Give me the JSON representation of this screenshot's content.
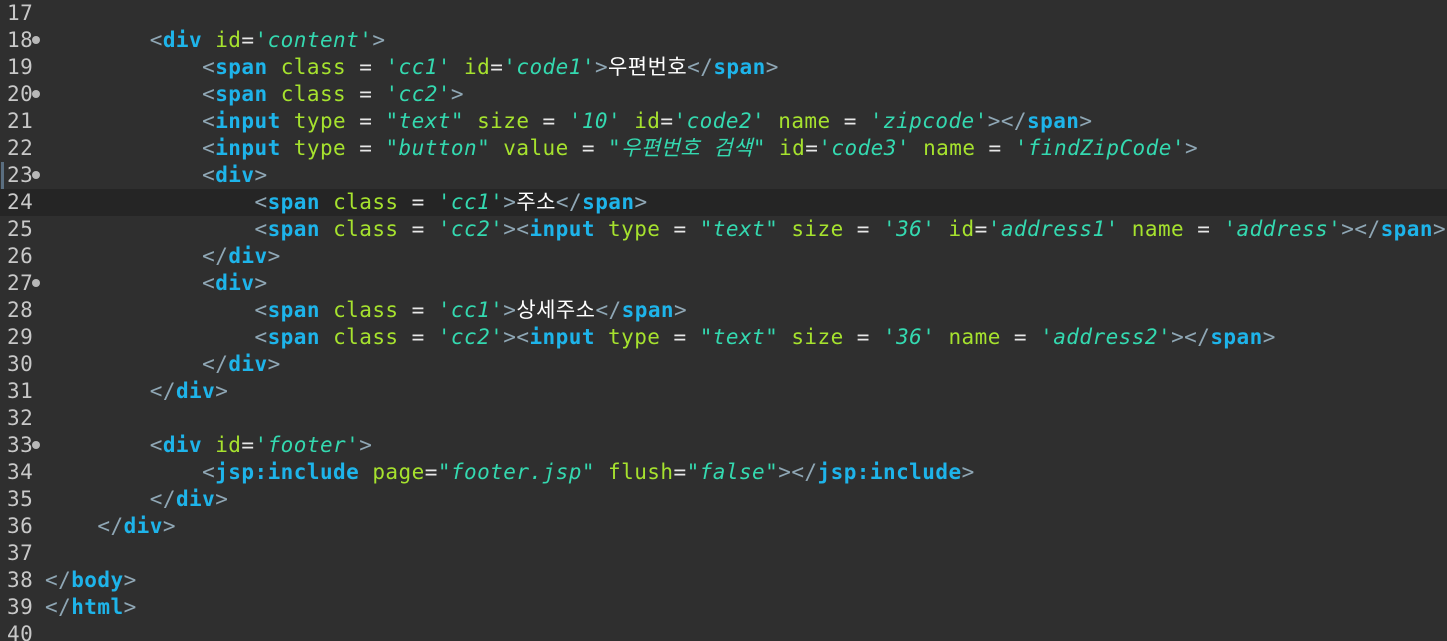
{
  "editor": {
    "first_line": 17,
    "current_line": 24,
    "lines": [
      {
        "n": "17",
        "fold": false,
        "indent": 0,
        "tokens": []
      },
      {
        "n": "18",
        "fold": true,
        "indent": 8,
        "tokens": [
          {
            "t": "bracket",
            "v": "<"
          },
          {
            "t": "tag",
            "v": "div"
          },
          {
            "t": "space",
            "v": " "
          },
          {
            "t": "attr",
            "v": "id"
          },
          {
            "t": "op",
            "v": "="
          },
          {
            "t": "str",
            "v": "'content'"
          },
          {
            "t": "bracket",
            "v": ">"
          }
        ]
      },
      {
        "n": "19",
        "fold": false,
        "indent": 12,
        "tokens": [
          {
            "t": "bracket",
            "v": "<"
          },
          {
            "t": "tag",
            "v": "span"
          },
          {
            "t": "space",
            "v": " "
          },
          {
            "t": "attr",
            "v": "class"
          },
          {
            "t": "op",
            "v": " = "
          },
          {
            "t": "str",
            "v": "'cc1'"
          },
          {
            "t": "space",
            "v": " "
          },
          {
            "t": "attr",
            "v": "id"
          },
          {
            "t": "op",
            "v": "="
          },
          {
            "t": "str",
            "v": "'code1'"
          },
          {
            "t": "bracket",
            "v": ">"
          },
          {
            "t": "text",
            "v": "우편번호"
          },
          {
            "t": "bracket",
            "v": "</"
          },
          {
            "t": "tag",
            "v": "span"
          },
          {
            "t": "bracket",
            "v": ">"
          }
        ]
      },
      {
        "n": "20",
        "fold": true,
        "indent": 12,
        "tokens": [
          {
            "t": "bracket",
            "v": "<"
          },
          {
            "t": "tag",
            "v": "span"
          },
          {
            "t": "space",
            "v": " "
          },
          {
            "t": "attr",
            "v": "class"
          },
          {
            "t": "op",
            "v": " = "
          },
          {
            "t": "str",
            "v": "'cc2'"
          },
          {
            "t": "bracket",
            "v": ">"
          }
        ]
      },
      {
        "n": "21",
        "fold": false,
        "indent": 12,
        "tokens": [
          {
            "t": "bracket",
            "v": "<"
          },
          {
            "t": "tag",
            "v": "input"
          },
          {
            "t": "space",
            "v": " "
          },
          {
            "t": "attr",
            "v": "type"
          },
          {
            "t": "op",
            "v": " = "
          },
          {
            "t": "str",
            "v": "\"text\""
          },
          {
            "t": "space",
            "v": " "
          },
          {
            "t": "attr",
            "v": "size"
          },
          {
            "t": "op",
            "v": " = "
          },
          {
            "t": "str",
            "v": "'10'"
          },
          {
            "t": "space",
            "v": " "
          },
          {
            "t": "attr",
            "v": "id"
          },
          {
            "t": "op",
            "v": "="
          },
          {
            "t": "str",
            "v": "'code2'"
          },
          {
            "t": "space",
            "v": " "
          },
          {
            "t": "attr",
            "v": "name"
          },
          {
            "t": "op",
            "v": " = "
          },
          {
            "t": "str",
            "v": "'zipcode'"
          },
          {
            "t": "bracket",
            "v": "></"
          },
          {
            "t": "tag",
            "v": "span"
          },
          {
            "t": "bracket",
            "v": ">"
          }
        ]
      },
      {
        "n": "22",
        "fold": false,
        "indent": 12,
        "tokens": [
          {
            "t": "bracket",
            "v": "<"
          },
          {
            "t": "tag",
            "v": "input"
          },
          {
            "t": "space",
            "v": " "
          },
          {
            "t": "attr",
            "v": "type"
          },
          {
            "t": "op",
            "v": " = "
          },
          {
            "t": "str",
            "v": "\"button\""
          },
          {
            "t": "space",
            "v": " "
          },
          {
            "t": "attr",
            "v": "value"
          },
          {
            "t": "op",
            "v": " = "
          },
          {
            "t": "str",
            "v": "\"우편번호 검색\""
          },
          {
            "t": "space",
            "v": " "
          },
          {
            "t": "attr",
            "v": "id"
          },
          {
            "t": "op",
            "v": "="
          },
          {
            "t": "str",
            "v": "'code3'"
          },
          {
            "t": "space",
            "v": " "
          },
          {
            "t": "attr",
            "v": "name"
          },
          {
            "t": "op",
            "v": " = "
          },
          {
            "t": "str",
            "v": "'findZipCode'"
          },
          {
            "t": "bracket",
            "v": ">"
          }
        ]
      },
      {
        "n": "23",
        "fold": true,
        "indent": 12,
        "tokens": [
          {
            "t": "bracket",
            "v": "<"
          },
          {
            "t": "tag",
            "v": "div"
          },
          {
            "t": "bracket",
            "v": ">"
          }
        ]
      },
      {
        "n": "24",
        "fold": false,
        "indent": 16,
        "tokens": [
          {
            "t": "bracket",
            "v": "<"
          },
          {
            "t": "tag",
            "v": "span"
          },
          {
            "t": "space",
            "v": " "
          },
          {
            "t": "attr",
            "v": "class"
          },
          {
            "t": "op",
            "v": " = "
          },
          {
            "t": "str",
            "v": "'cc1'"
          },
          {
            "t": "bracket",
            "v": ">"
          },
          {
            "t": "text",
            "v": "주소"
          },
          {
            "t": "bracket",
            "v": "</"
          },
          {
            "t": "tag",
            "v": "span"
          },
          {
            "t": "bracket",
            "v": ">"
          }
        ]
      },
      {
        "n": "25",
        "fold": false,
        "indent": 16,
        "tokens": [
          {
            "t": "bracket",
            "v": "<"
          },
          {
            "t": "tag",
            "v": "span"
          },
          {
            "t": "space",
            "v": " "
          },
          {
            "t": "attr",
            "v": "class"
          },
          {
            "t": "op",
            "v": " = "
          },
          {
            "t": "str",
            "v": "'cc2'"
          },
          {
            "t": "bracket",
            "v": "><"
          },
          {
            "t": "tag",
            "v": "input"
          },
          {
            "t": "space",
            "v": " "
          },
          {
            "t": "attr",
            "v": "type"
          },
          {
            "t": "op",
            "v": " = "
          },
          {
            "t": "str",
            "v": "\"text\""
          },
          {
            "t": "space",
            "v": " "
          },
          {
            "t": "attr",
            "v": "size"
          },
          {
            "t": "op",
            "v": " = "
          },
          {
            "t": "str",
            "v": "'36'"
          },
          {
            "t": "space",
            "v": " "
          },
          {
            "t": "attr",
            "v": "id"
          },
          {
            "t": "op",
            "v": "="
          },
          {
            "t": "str",
            "v": "'address1'"
          },
          {
            "t": "space",
            "v": " "
          },
          {
            "t": "attr",
            "v": "name"
          },
          {
            "t": "op",
            "v": " = "
          },
          {
            "t": "str",
            "v": "'address'"
          },
          {
            "t": "bracket",
            "v": "></"
          },
          {
            "t": "tag",
            "v": "span"
          },
          {
            "t": "bracket",
            "v": ">"
          }
        ]
      },
      {
        "n": "26",
        "fold": false,
        "indent": 12,
        "tokens": [
          {
            "t": "bracket",
            "v": "</"
          },
          {
            "t": "tag",
            "v": "div"
          },
          {
            "t": "bracket",
            "v": ">"
          }
        ]
      },
      {
        "n": "27",
        "fold": true,
        "indent": 12,
        "tokens": [
          {
            "t": "bracket",
            "v": "<"
          },
          {
            "t": "tag",
            "v": "div"
          },
          {
            "t": "bracket",
            "v": ">"
          }
        ]
      },
      {
        "n": "28",
        "fold": false,
        "indent": 16,
        "tokens": [
          {
            "t": "bracket",
            "v": "<"
          },
          {
            "t": "tag",
            "v": "span"
          },
          {
            "t": "space",
            "v": " "
          },
          {
            "t": "attr",
            "v": "class"
          },
          {
            "t": "op",
            "v": " = "
          },
          {
            "t": "str",
            "v": "'cc1'"
          },
          {
            "t": "bracket",
            "v": ">"
          },
          {
            "t": "text",
            "v": "상세주소"
          },
          {
            "t": "bracket",
            "v": "</"
          },
          {
            "t": "tag",
            "v": "span"
          },
          {
            "t": "bracket",
            "v": ">"
          }
        ]
      },
      {
        "n": "29",
        "fold": false,
        "indent": 16,
        "tokens": [
          {
            "t": "bracket",
            "v": "<"
          },
          {
            "t": "tag",
            "v": "span"
          },
          {
            "t": "space",
            "v": " "
          },
          {
            "t": "attr",
            "v": "class"
          },
          {
            "t": "op",
            "v": " = "
          },
          {
            "t": "str",
            "v": "'cc2'"
          },
          {
            "t": "bracket",
            "v": "><"
          },
          {
            "t": "tag",
            "v": "input"
          },
          {
            "t": "space",
            "v": " "
          },
          {
            "t": "attr",
            "v": "type"
          },
          {
            "t": "op",
            "v": " = "
          },
          {
            "t": "str",
            "v": "\"text\""
          },
          {
            "t": "space",
            "v": " "
          },
          {
            "t": "attr",
            "v": "size"
          },
          {
            "t": "op",
            "v": " = "
          },
          {
            "t": "str",
            "v": "'36'"
          },
          {
            "t": "space",
            "v": " "
          },
          {
            "t": "attr",
            "v": "name"
          },
          {
            "t": "op",
            "v": " = "
          },
          {
            "t": "str",
            "v": "'address2'"
          },
          {
            "t": "bracket",
            "v": "></"
          },
          {
            "t": "tag",
            "v": "span"
          },
          {
            "t": "bracket",
            "v": ">"
          }
        ]
      },
      {
        "n": "30",
        "fold": false,
        "indent": 12,
        "tokens": [
          {
            "t": "bracket",
            "v": "</"
          },
          {
            "t": "tag",
            "v": "div"
          },
          {
            "t": "bracket",
            "v": ">"
          }
        ]
      },
      {
        "n": "31",
        "fold": false,
        "indent": 8,
        "tokens": [
          {
            "t": "bracket",
            "v": "</"
          },
          {
            "t": "tag",
            "v": "div"
          },
          {
            "t": "bracket",
            "v": ">"
          }
        ]
      },
      {
        "n": "32",
        "fold": false,
        "indent": 0,
        "tokens": []
      },
      {
        "n": "33",
        "fold": true,
        "indent": 8,
        "tokens": [
          {
            "t": "bracket",
            "v": "<"
          },
          {
            "t": "tag",
            "v": "div"
          },
          {
            "t": "space",
            "v": " "
          },
          {
            "t": "attr",
            "v": "id"
          },
          {
            "t": "op",
            "v": "="
          },
          {
            "t": "str",
            "v": "'footer'"
          },
          {
            "t": "bracket",
            "v": ">"
          }
        ]
      },
      {
        "n": "34",
        "fold": false,
        "indent": 12,
        "tokens": [
          {
            "t": "bracket",
            "v": "<"
          },
          {
            "t": "tag",
            "v": "jsp:include"
          },
          {
            "t": "space",
            "v": " "
          },
          {
            "t": "attr",
            "v": "page"
          },
          {
            "t": "op",
            "v": "="
          },
          {
            "t": "str",
            "v": "\"footer.jsp\""
          },
          {
            "t": "space",
            "v": " "
          },
          {
            "t": "attr",
            "v": "flush"
          },
          {
            "t": "op",
            "v": "="
          },
          {
            "t": "str",
            "v": "\"false\""
          },
          {
            "t": "bracket",
            "v": "></"
          },
          {
            "t": "tag",
            "v": "jsp:include"
          },
          {
            "t": "bracket",
            "v": ">"
          }
        ]
      },
      {
        "n": "35",
        "fold": false,
        "indent": 8,
        "tokens": [
          {
            "t": "bracket",
            "v": "</"
          },
          {
            "t": "tag",
            "v": "div"
          },
          {
            "t": "bracket",
            "v": ">"
          }
        ]
      },
      {
        "n": "36",
        "fold": false,
        "indent": 4,
        "tokens": [
          {
            "t": "bracket",
            "v": "</"
          },
          {
            "t": "tag",
            "v": "div"
          },
          {
            "t": "bracket",
            "v": ">"
          }
        ]
      },
      {
        "n": "37",
        "fold": false,
        "indent": 0,
        "tokens": []
      },
      {
        "n": "38",
        "fold": false,
        "indent": 0,
        "tokens": [
          {
            "t": "bracket",
            "v": "</"
          },
          {
            "t": "tag",
            "v": "body"
          },
          {
            "t": "bracket",
            "v": ">"
          }
        ]
      },
      {
        "n": "39",
        "fold": false,
        "indent": 0,
        "tokens": [
          {
            "t": "bracket",
            "v": "</"
          },
          {
            "t": "tag",
            "v": "html"
          },
          {
            "t": "bracket",
            "v": ">"
          }
        ]
      },
      {
        "n": "40",
        "fold": false,
        "indent": 0,
        "tokens": []
      }
    ]
  }
}
